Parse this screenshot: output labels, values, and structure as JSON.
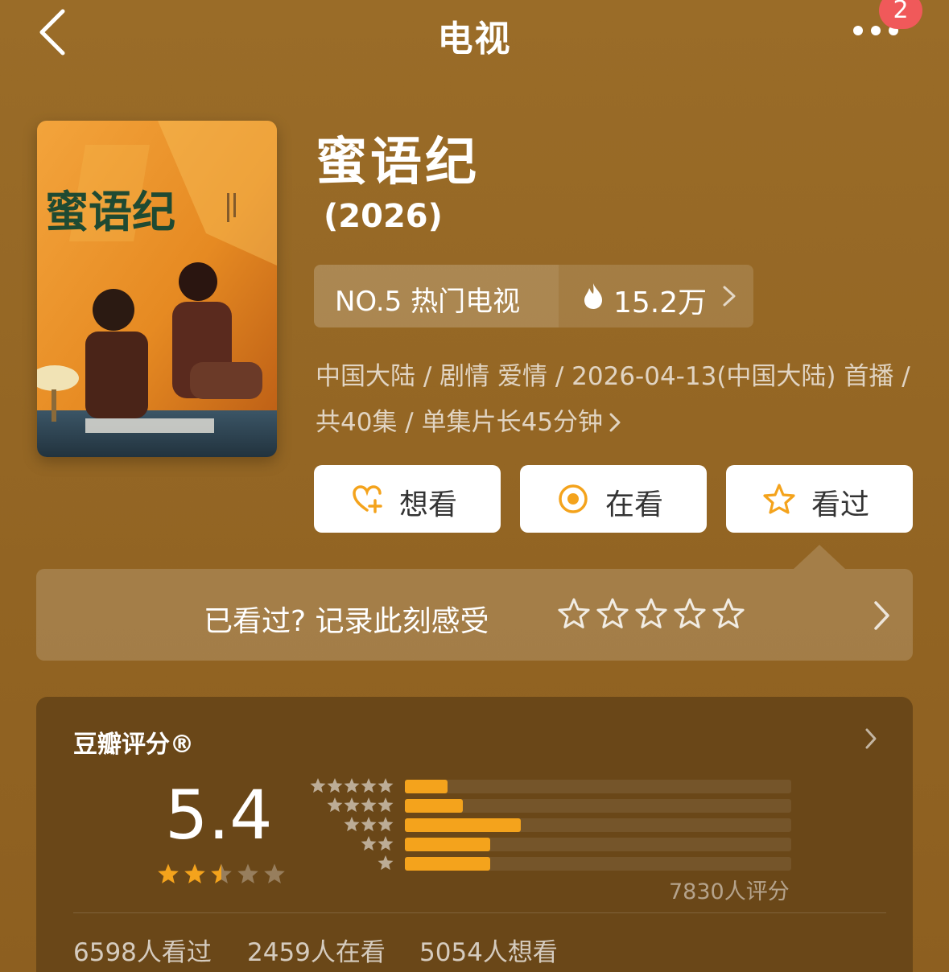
{
  "nav": {
    "title": "电视",
    "badge_count": "2",
    "back_icon": "chevron-left-icon",
    "more_icon": "more-dots-icon"
  },
  "show": {
    "title": "蜜语纪",
    "year": "(2026)",
    "poster_title": "蜜语纪",
    "rank_text": "NO.5 热门电视",
    "heat_text": "15.2万",
    "meta": "中国大陆 / 剧情 爱情 / 2026-04-13(中国大陆) 首播 / 共40集 / 单集片长45分钟"
  },
  "actions": {
    "want": "想看",
    "watching": "在看",
    "watched": "看过"
  },
  "record": {
    "prompt": "已看过? 记录此刻感受",
    "star_count": 5
  },
  "rating": {
    "title": "豆瓣评分®",
    "score": "5.4",
    "score_stars": 2.5,
    "distribution": [
      {
        "stars": 5,
        "fraction": 0.11
      },
      {
        "stars": 4,
        "fraction": 0.15
      },
      {
        "stars": 3,
        "fraction": 0.3
      },
      {
        "stars": 2,
        "fraction": 0.22
      },
      {
        "stars": 1,
        "fraction": 0.22
      }
    ],
    "count_text": "7830人评分",
    "watched_text": "6598人看过",
    "watching_text": "2459人在看",
    "want_text": "5054人想看"
  },
  "colors": {
    "accent": "#f4a31c",
    "badge": "#f0595a",
    "background": "#9a6c28",
    "panel": "#6a4718"
  }
}
